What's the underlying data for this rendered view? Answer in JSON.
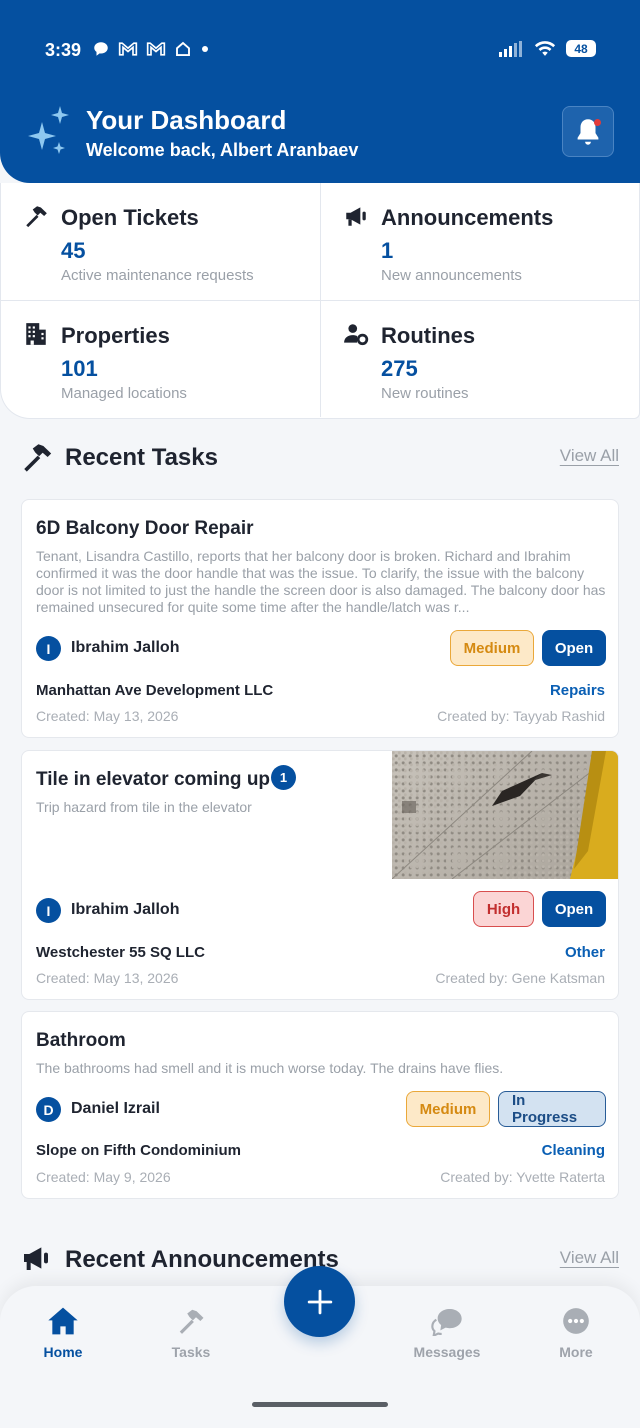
{
  "status_bar": {
    "time": "3:39",
    "battery": "48"
  },
  "header": {
    "title": "Your Dashboard",
    "subtitle": "Welcome back, Albert Aranbaev"
  },
  "stats": [
    {
      "label": "Open Tickets",
      "value": "45",
      "desc": "Active maintenance requests",
      "icon": "hammer-icon"
    },
    {
      "label": "Announcements",
      "value": "1",
      "desc": "New announcements",
      "icon": "megaphone-icon"
    },
    {
      "label": "Properties",
      "value": "101",
      "desc": "Managed locations",
      "icon": "building-icon"
    },
    {
      "label": "Routines",
      "value": "275",
      "desc": "New routines",
      "icon": "user-gear-icon"
    }
  ],
  "recent_tasks": {
    "title": "Recent Tasks",
    "view_all": "View All",
    "items": [
      {
        "title": "6D Balcony Door Repair",
        "desc": "Tenant, Lisandra Castillo, reports that her balcony door is broken. Richard and Ibrahim confirmed it was the door handle that was the issue. To clarify, the issue with the balcony door is not limited to just the handle the screen door is also damaged. The balcony door has remained unsecured for quite some time after the handle/latch was r...",
        "avatar": "I",
        "assignee": "Ibrahim Jalloh",
        "priority": "Medium",
        "status": "Open",
        "company": "Manhattan Ave Development LLC",
        "category": "Repairs",
        "created": "Created: May 13, 2026",
        "created_by": "Created by: Tayyab Rashid"
      },
      {
        "title": "Tile in elevator coming up",
        "count": "1",
        "desc": "Trip hazard from tile in the elevator",
        "avatar": "I",
        "assignee": "Ibrahim Jalloh",
        "priority": "High",
        "status": "Open",
        "company": "Westchester 55 SQ LLC",
        "category": "Other",
        "created": "Created: May 13, 2026",
        "created_by": "Created by: Gene Katsman"
      },
      {
        "title": "Bathroom",
        "desc": "The bathrooms had smell and it is much worse today. The drains have flies.",
        "avatar": "D",
        "assignee": "Daniel Izrail",
        "priority": "Medium",
        "status": "In Progress",
        "company": "Slope on Fifth Condominium",
        "category": "Cleaning",
        "created": "Created: May 9, 2026",
        "created_by": "Created by: Yvette Raterta"
      }
    ]
  },
  "recent_announcements": {
    "title": "Recent Announcements",
    "view_all": "View All"
  },
  "nav": {
    "home": "Home",
    "tasks": "Tasks",
    "messages": "Messages",
    "more": "More"
  },
  "colors": {
    "primary": "#0550a0",
    "medium": "#d58a12",
    "high": "#c22f2f",
    "muted": "#9aa0a8"
  }
}
